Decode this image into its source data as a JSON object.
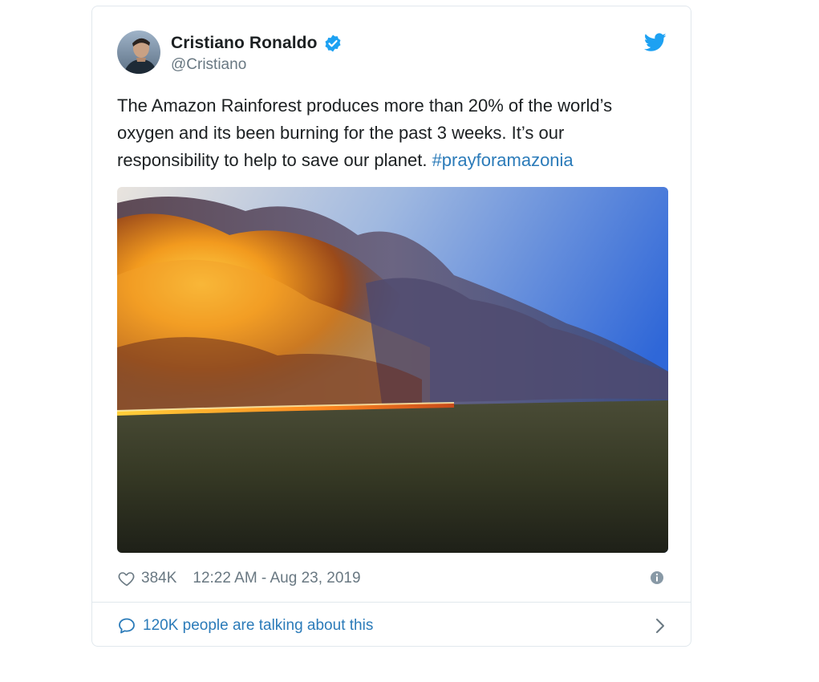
{
  "tweet": {
    "author": {
      "display_name": "Cristiano Ronaldo",
      "handle": "@Cristiano",
      "verified": true,
      "avatar_icon": "profile-photo"
    },
    "text_plain": "The Amazon Rainforest produces more than 20% of the world’s oxygen and its been burning for the past 3 weeks. It’s our responsibility to help to save our planet. ",
    "hashtag": "#prayforamazonia",
    "media_icon": "wildfire-photo",
    "likes": "384K",
    "timestamp": "12:22 AM - Aug 23, 2019",
    "talking": "120K people are talking about this"
  },
  "colors": {
    "link": "#2b7bb9",
    "text": "#1c2022",
    "muted": "#697882",
    "border": "#e1e8ed",
    "twitter_blue": "#1da1f2"
  },
  "icons": {
    "brand": "twitter-bird-icon",
    "verified": "verified-badge-icon",
    "like": "heart-icon",
    "info": "info-icon",
    "reply": "speech-bubble-icon",
    "more": "chevron-right-icon"
  }
}
